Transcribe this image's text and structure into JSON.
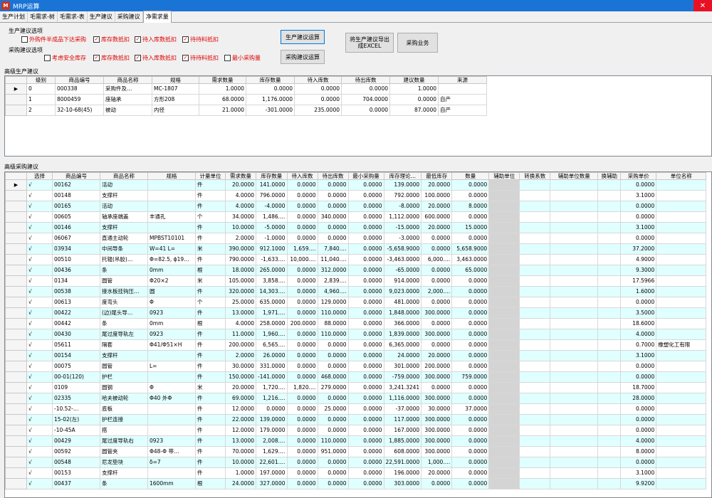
{
  "window": {
    "title": "MRP运算",
    "icon": "M",
    "close": "✕"
  },
  "tabs": [
    "生产计划",
    "毛需求-树",
    "毛需求-表",
    "生产建议",
    "采购建议",
    "净需求量"
  ],
  "options": {
    "production_label": "生产建议选项",
    "purchase_label": "采购建议选项",
    "production_checks": [
      {
        "label": "外购件半成品下达采购",
        "checked": false
      },
      {
        "label": "库存数抵扣",
        "checked": true
      },
      {
        "label": "待入库数抵扣",
        "checked": true
      },
      {
        "label": "待待料抵扣",
        "checked": true
      }
    ],
    "purchase_checks": [
      {
        "label": "考虑安全库存",
        "checked": false
      },
      {
        "label": "库存数抵扣",
        "checked": true
      },
      {
        "label": "待入库数抵扣",
        "checked": true
      },
      {
        "label": "待待料抵扣",
        "checked": true
      },
      {
        "label": "最小采购量",
        "checked": false
      }
    ],
    "buttons": {
      "prod_calc": "生产建议运算",
      "purch_calc": "采购建议运算",
      "export": "将生产建议导出\n成EXCEL",
      "purch_business": "采购业务"
    }
  },
  "production": {
    "title": "高级生产建议",
    "columns": [
      "级别",
      "商品编号",
      "商品名称",
      "规格",
      "需求数量",
      "库存数量",
      "待入库数",
      "待出库数",
      "建议数量",
      "来源"
    ],
    "rows": [
      [
        "0",
        "000338",
        "采购件及…",
        "MC-1807",
        "1.0000",
        "0.0000",
        "0.0000",
        "0.0000",
        "1.0000",
        ""
      ],
      [
        "1",
        "8000459",
        "座轴承",
        "方形208",
        "68.0000",
        "1,176.0000",
        "0.0000",
        "704.0000",
        "0.0000",
        "自产"
      ],
      [
        "2",
        "32-10-68(45)",
        "被动",
        "内径",
        "21.0000",
        "-301.0000",
        "235.0000",
        "0.0000",
        "87.0000",
        "自产"
      ]
    ]
  },
  "purchase": {
    "title": "高级采购建议",
    "columns": [
      "选择",
      "商品编号",
      "商品名称",
      "规格",
      "计量单位",
      "需求数量",
      "库存数量",
      "待入库数",
      "待出库数",
      "最小采购量",
      "库存理论…",
      "最低库存",
      "数量",
      "辅助单位",
      "转换系数",
      "辅助单位数量",
      "换辅助",
      "采购单价",
      "单位名称"
    ],
    "rows": [
      [
        "√",
        "00162",
        "活动",
        "",
        "件",
        "20.0000",
        "141.0000",
        "0.0000",
        "0.0000",
        "0.0000",
        "139.0000",
        "20.0000",
        "0.0000",
        "",
        "",
        "",
        "",
        "0.0000",
        ""
      ],
      [
        "√",
        "00148",
        "支撑杆",
        "",
        "件",
        "4.0000",
        "796.0000",
        "0.0000",
        "0.0000",
        "0.0000",
        "792.0000",
        "100.0000",
        "0.0000",
        "",
        "",
        "",
        "",
        "3.1000",
        ""
      ],
      [
        "√",
        "00165",
        "活动",
        "",
        "件",
        "4.0000",
        "-4.0000",
        "0.0000",
        "0.0000",
        "0.0000",
        "-8.0000",
        "20.0000",
        "8.0000",
        "",
        "",
        "",
        "",
        "0.0000",
        ""
      ],
      [
        "√",
        "00605",
        "轴承座端盖",
        "丰通孔",
        "个",
        "34.0000",
        "1,486.…",
        "0.0000",
        "340.0000",
        "0.0000",
        "1,112.0000",
        "600.0000",
        "0.0000",
        "",
        "",
        "",
        "",
        "0.0000",
        ""
      ],
      [
        "√",
        "00146",
        "支撑杆",
        "",
        "件",
        "10.0000",
        "-5.0000",
        "0.0000",
        "0.0000",
        "0.0000",
        "-15.0000",
        "20.0000",
        "15.0000",
        "",
        "",
        "",
        "",
        "3.1000",
        ""
      ],
      [
        "√",
        "06067",
        "直通主动轮",
        "MPBST10101",
        "件",
        "2.0000",
        "-1.0000",
        "0.0000",
        "0.0000",
        "0.0000",
        "-3.0000",
        "0.0000",
        "0.0000",
        "",
        "",
        "",
        "",
        "0.0000",
        ""
      ],
      [
        "√",
        "03934",
        "中间导条",
        "W=41 L=",
        "米",
        "390.0000",
        "912.1000",
        "1,659.…",
        "7,840.…",
        "0.0000",
        "-5,658.9000",
        "0.0000",
        "5,658.9000",
        "",
        "",
        "",
        "",
        "37.2000",
        ""
      ],
      [
        "√",
        "00510",
        "托辊(吊胶)…",
        "Φ=82.5, ϕ19…",
        "件",
        "790.0000",
        "-1,633.…",
        "10,000.…",
        "11,040.…",
        "0.0000",
        "-3,463.0000",
        "6,000.…",
        "3,463.0000",
        "",
        "",
        "",
        "",
        "4.9000",
        ""
      ],
      [
        "√",
        "00436",
        "条",
        "0mm",
        "根",
        "18.0000",
        "265.0000",
        "0.0000",
        "312.0000",
        "0.0000",
        "-65.0000",
        "0.0000",
        "65.0000",
        "",
        "",
        "",
        "",
        "9.3000",
        ""
      ],
      [
        "√",
        "0134",
        "圆管",
        "Φ20×2",
        "米",
        "105.0000",
        "3,858.…",
        "0.0000",
        "2,839.…",
        "0.0000",
        "914.0000",
        "0.0000",
        "0.0000",
        "",
        "",
        "",
        "",
        "17.5966",
        ""
      ],
      [
        "√",
        "00538",
        "接水板挂钩压…",
        "圆",
        "件",
        "320.0000",
        "14,303.…",
        "0.0000",
        "4,960.…",
        "0.0000",
        "9,023.0000",
        "2,000.…",
        "0.0000",
        "",
        "",
        "",
        "",
        "1.6000",
        ""
      ],
      [
        "√",
        "00613",
        "度弯头",
        "Φ",
        "个",
        "25.0000",
        "635.0000",
        "0.0000",
        "129.0000",
        "0.0000",
        "481.0000",
        "0.0000",
        "0.0000",
        "",
        "",
        "",
        "",
        "0.0000",
        ""
      ],
      [
        "√",
        "00422",
        "(边)尾头导…",
        "0923",
        "件",
        "13.0000",
        "1,971.…",
        "0.0000",
        "110.0000",
        "0.0000",
        "1,848.0000",
        "300.0000",
        "0.0000",
        "",
        "",
        "",
        "",
        "3.5000",
        ""
      ],
      [
        "√",
        "00442",
        "条",
        "0mm",
        "根",
        "4.0000",
        "258.0000",
        "200.0000",
        "88.0000",
        "0.0000",
        "366.0000",
        "0.0000",
        "0.0000",
        "",
        "",
        "",
        "",
        "18.6000",
        ""
      ],
      [
        "√",
        "00430",
        "尾过度导轨左",
        "0923",
        "件",
        "11.0000",
        "1,960.…",
        "0.0000",
        "110.0000",
        "0.0000",
        "1,839.0000",
        "300.0000",
        "0.0000",
        "",
        "",
        "",
        "",
        "4.0000",
        ""
      ],
      [
        "√",
        "05611",
        "隔套",
        "Φ41/Φ51×H",
        "件",
        "200.0000",
        "6,565.…",
        "0.0000",
        "0.0000",
        "0.0000",
        "6,365.0000",
        "0.0000",
        "0.0000",
        "",
        "",
        "",
        "",
        "0.7000",
        "橡塑化工有限"
      ],
      [
        "√",
        "00154",
        "支撑杆",
        "",
        "件",
        "2.0000",
        "26.0000",
        "0.0000",
        "0.0000",
        "0.0000",
        "24.0000",
        "20.0000",
        "0.0000",
        "",
        "",
        "",
        "",
        "3.1000",
        ""
      ],
      [
        "√",
        "00075",
        "圆管",
        "L=",
        "件",
        "30.0000",
        "331.0000",
        "0.0000",
        "0.0000",
        "0.0000",
        "301.0000",
        "200.0000",
        "0.0000",
        "",
        "",
        "",
        "",
        "0.0000",
        ""
      ],
      [
        "√",
        "00-01(120)",
        "护栏",
        "",
        "件",
        "150.0000",
        "-141.0000",
        "0.0000",
        "468.0000",
        "0.0000",
        "-759.0000",
        "300.0000",
        "759.0000",
        "",
        "",
        "",
        "",
        "0.0000",
        ""
      ],
      [
        "√",
        "0109",
        "圆钢",
        "Φ",
        "米",
        "20.0000",
        "1,720.…",
        "1,820.…",
        "279.0000",
        "0.0000",
        "3,241.3241",
        "0.0000",
        "0.0000",
        "",
        "",
        "",
        "",
        "18.7000",
        ""
      ],
      [
        "√",
        "02335",
        "哈夫被动轮",
        "Φ40 外Φ",
        "件",
        "69.0000",
        "1,216.…",
        "0.0000",
        "0.0000",
        "0.0000",
        "1,116.0000",
        "300.0000",
        "0.0000",
        "",
        "",
        "",
        "",
        "28.0000",
        ""
      ],
      [
        "√",
        "-10.52-…",
        "底板",
        "",
        "件",
        "12.0000",
        "0.0000",
        "0.0000",
        "25.0000",
        "0.0000",
        "-37.0000",
        "30.0000",
        "37.0000",
        "",
        "",
        "",
        "",
        "0.0000",
        ""
      ],
      [
        "√",
        "15-02(左)",
        "护栏连接",
        "",
        "件",
        "22.0000",
        "139.0000",
        "0.0000",
        "0.0000",
        "0.0000",
        "117.0000",
        "300.0000",
        "0.0000",
        "",
        "",
        "",
        "",
        "0.0000",
        ""
      ],
      [
        "√",
        "-10-45A",
        "搭",
        "",
        "件",
        "12.0000",
        "179.0000",
        "0.0000",
        "0.0000",
        "0.0000",
        "167.0000",
        "300.0000",
        "0.0000",
        "",
        "",
        "",
        "",
        "0.0000",
        ""
      ],
      [
        "√",
        "00429",
        "尾过度导轨右",
        "0923",
        "件",
        "13.0000",
        "2,008.…",
        "0.0000",
        "110.0000",
        "0.0000",
        "1,885.0000",
        "300.0000",
        "0.0000",
        "",
        "",
        "",
        "",
        "4.0000",
        ""
      ],
      [
        "√",
        "00592",
        "圆管夹",
        "Φ48-Φ 带…",
        "件",
        "70.0000",
        "1,629.…",
        "0.0000",
        "951.0000",
        "0.0000",
        "608.0000",
        "300.0000",
        "0.0000",
        "",
        "",
        "",
        "",
        "8.0000",
        ""
      ],
      [
        "√",
        "00548",
        "尼龙垫块",
        "δ=7",
        "件",
        "10.0000",
        "22,601.…",
        "0.0000",
        "0.0000",
        "0.0000",
        "22,591.0000",
        "1,000.…",
        "0.0000",
        "",
        "",
        "",
        "",
        "0.0000",
        ""
      ],
      [
        "√",
        "00153",
        "支撑杆",
        "",
        "件",
        "1.0000",
        "197.0000",
        "0.0000",
        "0.0000",
        "0.0000",
        "196.0000",
        "20.0000",
        "0.0000",
        "",
        "",
        "",
        "",
        "3.1000",
        ""
      ],
      [
        "√",
        "00437",
        "条",
        "1600mm",
        "根",
        "24.0000",
        "327.0000",
        "0.0000",
        "0.0000",
        "0.0000",
        "303.0000",
        "0.0000",
        "0.0000",
        "",
        "",
        "",
        "",
        "9.9200",
        ""
      ]
    ]
  }
}
